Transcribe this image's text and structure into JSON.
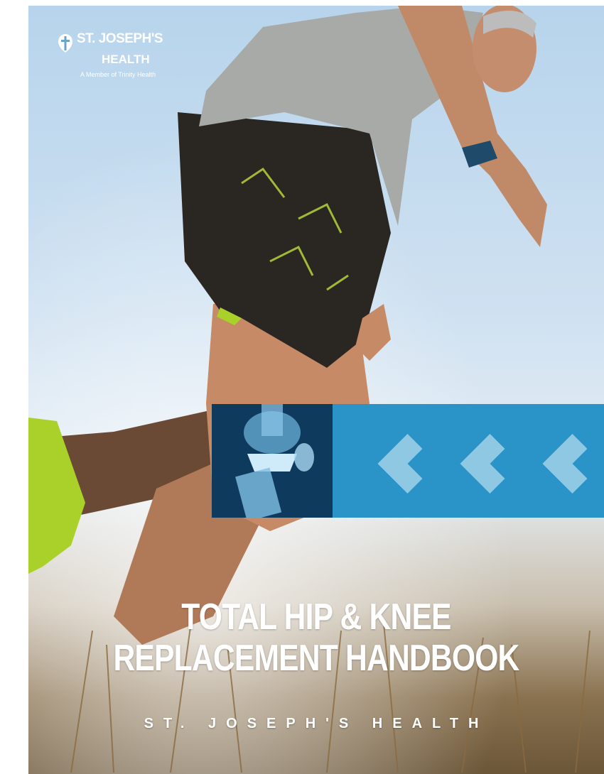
{
  "logo": {
    "name_line1": "ST. JOSEPH'S",
    "name_line2": "HEALTH",
    "member_line": "A Member of Trinity Health"
  },
  "cover": {
    "title_line1": "TOTAL HIP & KNEE",
    "title_line2": "REPLACEMENT HANDBOOK",
    "subtitle": "ST. JOSEPH'S HEALTH"
  },
  "icons": {
    "logo_mark": "cross-heart-icon",
    "banner_chevrons": "chevron-left-icon"
  },
  "colors": {
    "banner_blue": "#2a93c8",
    "chevron": "#8fc8e3",
    "xray_bg": "#0a2c4a",
    "shoe_green": "#a9d12a"
  }
}
